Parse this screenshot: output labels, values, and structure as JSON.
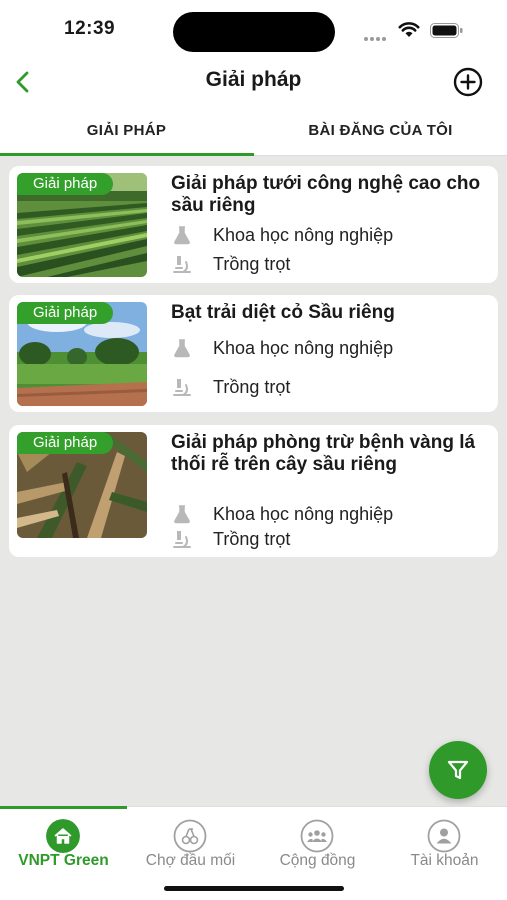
{
  "status_bar": {
    "time": "12:39"
  },
  "nav": {
    "title": "Giải pháp"
  },
  "tabs": [
    {
      "label": "GIẢI PHÁP",
      "active": true
    },
    {
      "label": "BÀI ĐĂNG CỦA TÔI",
      "active": false
    }
  ],
  "cards": [
    {
      "badge": "Giải pháp",
      "title": "Giải pháp tưới công nghệ cao cho sầu riêng",
      "field": "Khoa học nông nghiệp",
      "category": "Trồng trọt"
    },
    {
      "badge": "Giải pháp",
      "title": "Bạt trải diệt cỏ Sầu riêng",
      "field": "Khoa học nông nghiệp",
      "category": "Trồng trọt"
    },
    {
      "badge": "Giải pháp",
      "title": "Giải pháp phòng trừ bệnh vàng lá thối rễ trên cây sầu riêng",
      "field": "Khoa học nông nghiệp",
      "category": "Trồng trọt"
    }
  ],
  "bottom_nav": [
    {
      "label": "VNPT Green",
      "icon": "home-icon",
      "active": true
    },
    {
      "label": "Chợ đầu mối",
      "icon": "market-icon",
      "active": false
    },
    {
      "label": "Cộng đồng",
      "icon": "community-icon",
      "active": false
    },
    {
      "label": "Tài khoản",
      "icon": "account-icon",
      "active": false
    }
  ],
  "colors": {
    "accent": "#2f9a2a",
    "badge": "#33a02c",
    "background": "#e7e8e6"
  }
}
